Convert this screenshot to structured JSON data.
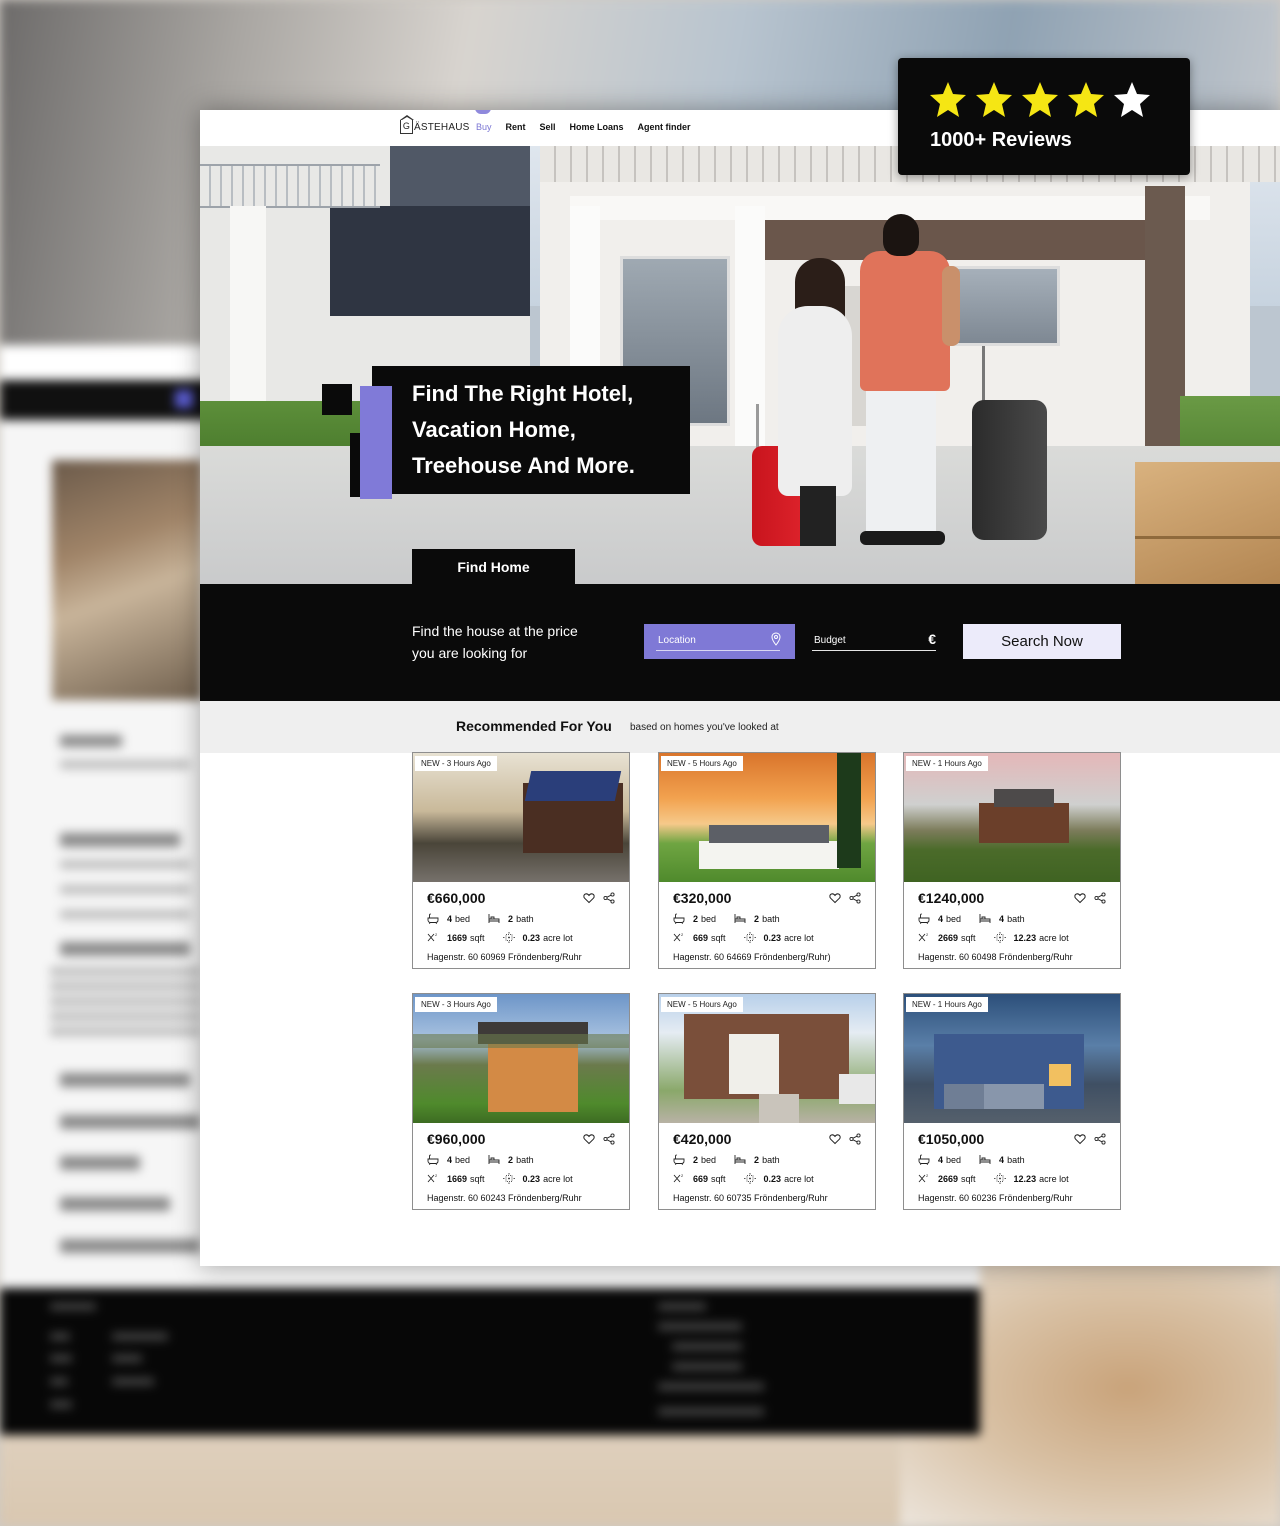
{
  "overlay": {
    "rating_stars": 4.5,
    "reviews_label": "1000+ Reviews"
  },
  "nav": {
    "logo_g": "G",
    "logo_text": "ÄSTEHAUS",
    "links": [
      "Buy",
      "Rent",
      "Sell",
      "Home Loans",
      "Agent finder"
    ],
    "active": "Buy"
  },
  "hero": {
    "title_lines": [
      "Find The Right Hotel,",
      "Vacation Home,",
      "Treehouse And More."
    ],
    "tab_label": "Find Home"
  },
  "search": {
    "prompt_line1": "Find the house at the price",
    "prompt_line2": "you are looking for",
    "location_placeholder": "Location",
    "budget_placeholder": "Budget",
    "currency_symbol": "€",
    "button_label": "Search Now",
    "accent_color": "#807ad8"
  },
  "recommended": {
    "title": "Recommended For You",
    "subtitle": "based on homes you've looked at",
    "listings": [
      {
        "badge": "NEW - 3 Hours Ago",
        "price": "€660,000",
        "beds": "4",
        "bed_label": "bed",
        "baths": "2",
        "bath_label": "bath",
        "sqft": "1669",
        "sqft_label": "sqft",
        "lot": "0.23",
        "lot_label": "acre lot",
        "address": "Hagenstr. 60 60969 Fröndenberg/Ruhr"
      },
      {
        "badge": "NEW - 5 Hours Ago",
        "price": "€320,000",
        "beds": "2",
        "bed_label": "bed",
        "baths": "2",
        "bath_label": "bath",
        "sqft": "669",
        "sqft_label": "sqft",
        "lot": "0.23",
        "lot_label": "acre lot",
        "address": "Hagenstr. 60 64669 Fröndenberg/Ruhr)"
      },
      {
        "badge": "NEW - 1 Hours Ago",
        "price": "€1240,000",
        "beds": "4",
        "bed_label": "bed",
        "baths": "4",
        "bath_label": "bath",
        "sqft": "2669",
        "sqft_label": "sqft",
        "lot": "12.23",
        "lot_label": "acre lot",
        "address": "Hagenstr. 60 60498 Fröndenberg/Ruhr"
      },
      {
        "badge": "NEW - 3 Hours Ago",
        "price": "€960,000",
        "beds": "4",
        "bed_label": "bed",
        "baths": "2",
        "bath_label": "bath",
        "sqft": "1669",
        "sqft_label": "sqft",
        "lot": "0.23",
        "lot_label": "acre lot",
        "address": "Hagenstr. 60 60243 Fröndenberg/Ruhr"
      },
      {
        "badge": "NEW - 5 Hours Ago",
        "price": "€420,000",
        "beds": "2",
        "bed_label": "bed",
        "baths": "2",
        "bath_label": "bath",
        "sqft": "669",
        "sqft_label": "sqft",
        "lot": "0.23",
        "lot_label": "acre lot",
        "address": "Hagenstr. 60 60735 Fröndenberg/Ruhr"
      },
      {
        "badge": "NEW - 1 Hours Ago",
        "price": "€1050,000",
        "beds": "4",
        "bed_label": "bed",
        "baths": "4",
        "bath_label": "bath",
        "sqft": "2669",
        "sqft_label": "sqft",
        "lot": "12.23",
        "lot_label": "acre lot",
        "address": "Hagenstr. 60 60236 Fröndenberg/Ruhr"
      }
    ]
  },
  "icons": {
    "bed": "bathtub-icon",
    "bath": "bed-icon",
    "area": "area-icon",
    "lot": "lot-icon",
    "favorite": "heart-icon",
    "share": "share-icon",
    "location": "location-pin-icon"
  }
}
